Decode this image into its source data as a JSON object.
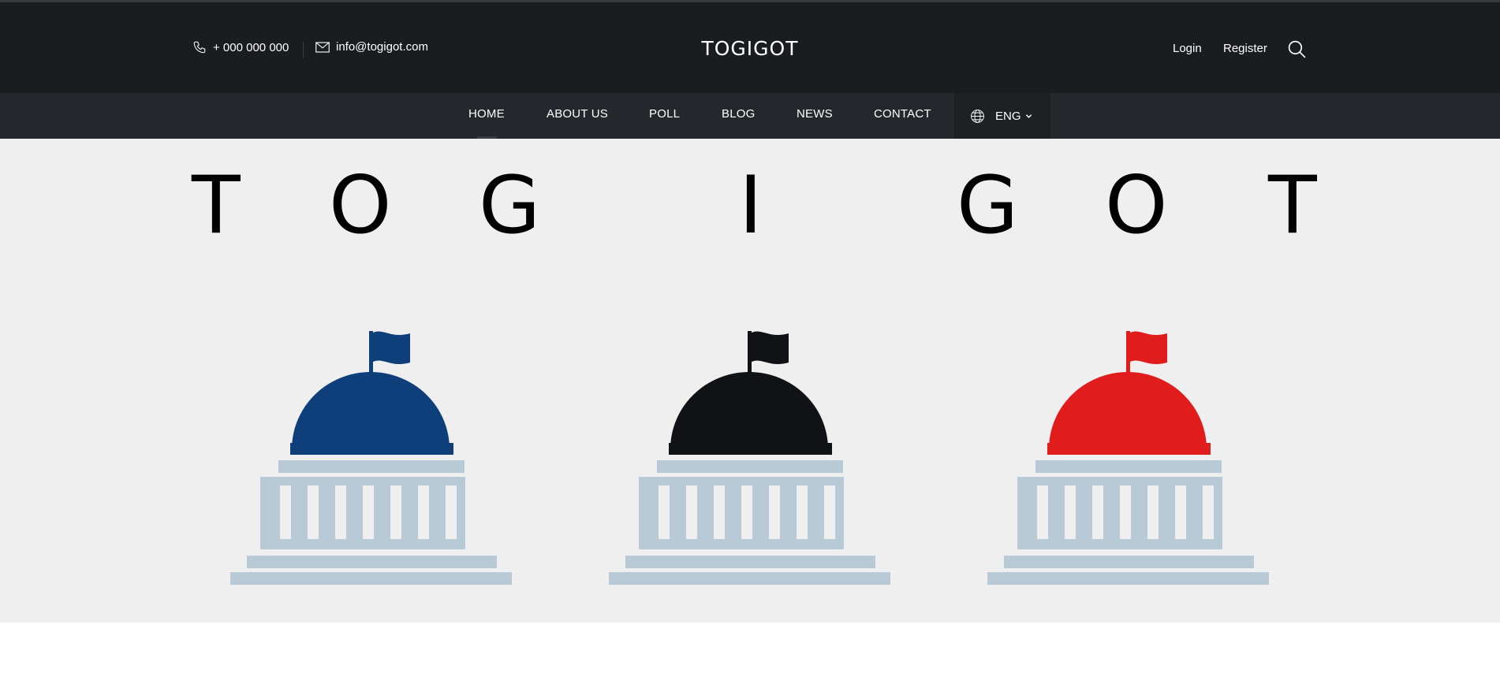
{
  "header": {
    "phone": "+ 000 000 000",
    "email": "info@togigot.com",
    "brand": "TOGIGOT",
    "login": "Login",
    "register": "Register",
    "icons": {
      "phone": "phone-icon",
      "email": "mail-icon",
      "search": "search-icon"
    }
  },
  "nav": {
    "items": [
      "HOME",
      "ABOUT US",
      "POLL",
      "BLOG",
      "NEWS",
      "CONTACT"
    ],
    "active": "HOME",
    "language": "ENG",
    "icons": {
      "language": "globe-icon",
      "dropdown": "chevron-down-icon"
    }
  },
  "hero": {
    "letters": [
      "T",
      "O",
      "G",
      "I",
      "G",
      "O",
      "T"
    ],
    "capitols": [
      {
        "name": "blue",
        "dome_color": "#0e3f7a"
      },
      {
        "name": "black",
        "dome_color": "#111216"
      },
      {
        "name": "red",
        "dome_color": "#e01c1c"
      }
    ],
    "building_color": "#b8cad6"
  },
  "colors": {
    "topbar": "#1b1c20",
    "navbar": "#26272c",
    "hero_background": "#efefef"
  }
}
